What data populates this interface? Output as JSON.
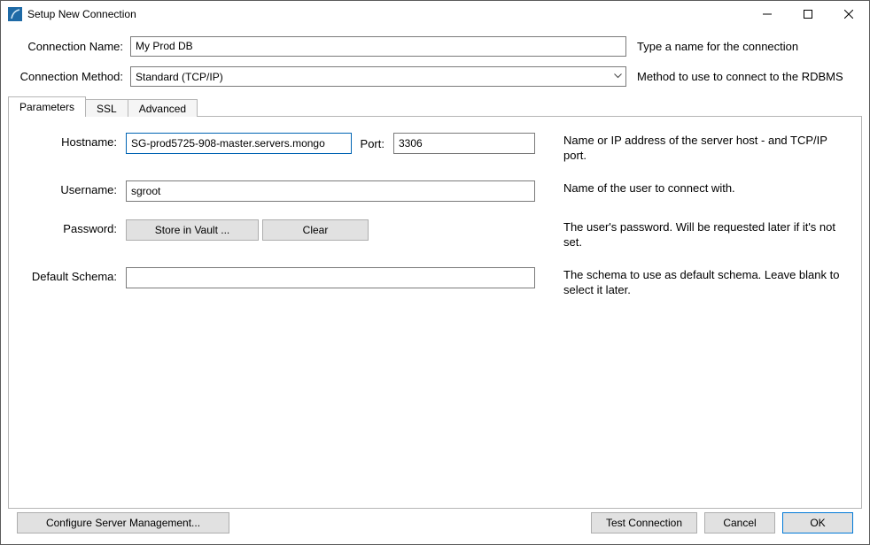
{
  "window": {
    "title": "Setup New Connection"
  },
  "header": {
    "conn_name_label": "Connection Name:",
    "conn_name_value": "My Prod DB",
    "conn_name_hint": "Type a name for the connection",
    "conn_method_label": "Connection Method:",
    "conn_method_value": "Standard (TCP/IP)",
    "conn_method_hint": "Method to use to connect to the RDBMS"
  },
  "tabs": {
    "parameters": "Parameters",
    "ssl": "SSL",
    "advanced": "Advanced"
  },
  "form": {
    "hostname_label": "Hostname:",
    "hostname_value": "SG-prod5725-908-master.servers.mongo",
    "port_label": "Port:",
    "port_value": "3306",
    "hostname_hint": "Name or IP address of the server host - and TCP/IP port.",
    "username_label": "Username:",
    "username_value": "sgroot",
    "username_hint": "Name of the user to connect with.",
    "password_label": "Password:",
    "store_vault_label": "Store in Vault ...",
    "clear_label": "Clear",
    "password_hint": "The user's password. Will be requested later if it's not set.",
    "schema_label": "Default Schema:",
    "schema_value": "",
    "schema_hint": "The schema to use as default schema. Leave blank to select it later."
  },
  "footer": {
    "configure_label": "Configure Server Management...",
    "test_label": "Test Connection",
    "cancel_label": "Cancel",
    "ok_label": "OK"
  }
}
